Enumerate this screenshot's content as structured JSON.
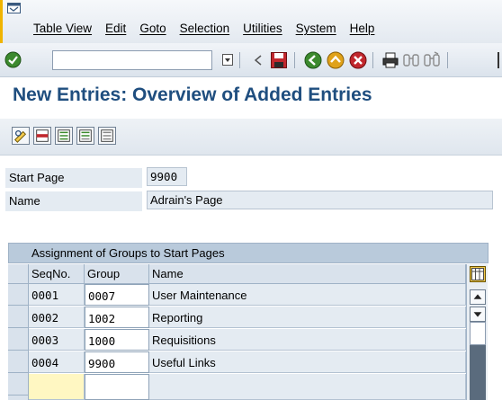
{
  "menu": {
    "items": [
      "Table View",
      "Edit",
      "Goto",
      "Selection",
      "Utilities",
      "System",
      "Help"
    ]
  },
  "toolbar": {
    "command_field": {
      "value": "",
      "placeholder": ""
    },
    "icons": [
      "enter-icon",
      "save-icon",
      "back-icon",
      "exit-icon",
      "cancel-icon",
      "print-icon",
      "find-icon",
      "find-next-icon"
    ]
  },
  "page": {
    "title": "New Entries: Overview of Added Entries"
  },
  "form": {
    "start_page": {
      "label": "Start Page",
      "value": "9900"
    },
    "name": {
      "label": "Name",
      "value": "Adrain's Page"
    }
  },
  "table": {
    "title": "Assignment of Groups to Start Pages",
    "columns": [
      "SeqNo.",
      "Group",
      "Name"
    ],
    "rows": [
      {
        "seq": "0001",
        "group": "0007",
        "name": "User Maintenance"
      },
      {
        "seq": "0002",
        "group": "1002",
        "name": "Reporting"
      },
      {
        "seq": "0003",
        "group": "1000",
        "name": "Requisitions"
      },
      {
        "seq": "0004",
        "group": "9900",
        "name": "Useful Links"
      },
      {
        "seq": "",
        "group": "",
        "name": ""
      }
    ]
  },
  "colors": {
    "title": "#1f4e7f",
    "accent_stripe": "#f0b400",
    "table_header": "#b9cadb",
    "new_row": "#fff7c2"
  }
}
